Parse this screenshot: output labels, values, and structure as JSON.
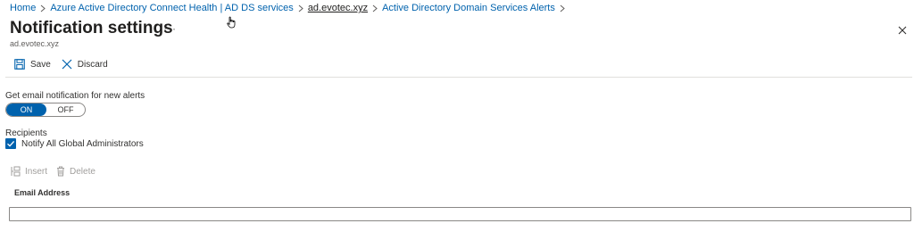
{
  "breadcrumb": {
    "items": [
      {
        "label": "Home"
      },
      {
        "label": "Azure Active Directory Connect Health | AD DS services"
      },
      {
        "label": "ad.evotec.xyz"
      },
      {
        "label": "Active Directory Domain Services Alerts"
      }
    ]
  },
  "header": {
    "title": "Notification settings",
    "more": "···",
    "subtitle": "ad.evotec.xyz"
  },
  "toolbar": {
    "save_label": "Save",
    "discard_label": "Discard"
  },
  "notification": {
    "label": "Get email notification for new alerts",
    "on_label": "ON",
    "off_label": "OFF",
    "selected": "ON"
  },
  "recipients": {
    "label": "Recipients",
    "notify_admins_label": "Notify All Global Administrators",
    "notify_admins_checked": true
  },
  "grid": {
    "insert_label": "Insert",
    "delete_label": "Delete",
    "column_email": "Email Address",
    "email_value": ""
  },
  "colors": {
    "accent": "#0062ad",
    "link": "#0062ad",
    "disabled": "#a19f9d"
  }
}
